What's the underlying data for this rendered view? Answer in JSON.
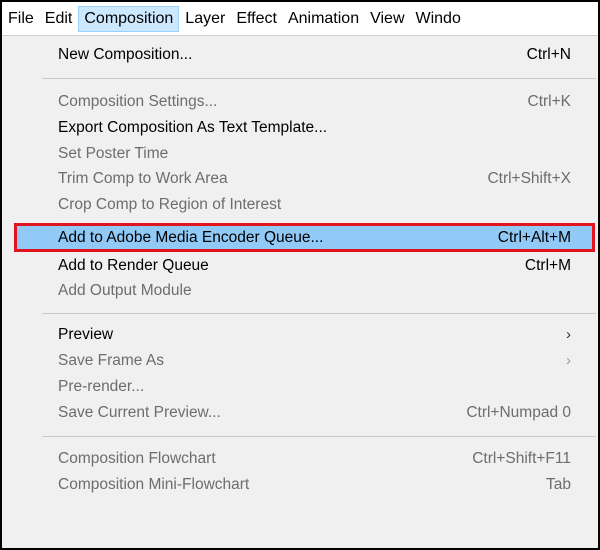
{
  "menubar": {
    "items": [
      "File",
      "Edit",
      "Composition",
      "Layer",
      "Effect",
      "Animation",
      "View",
      "Windo"
    ]
  },
  "menu": {
    "items": [
      {
        "label": "New Composition...",
        "shortcut": "Ctrl+N",
        "enabled": true
      },
      {
        "label": "Composition Settings...",
        "shortcut": "Ctrl+K",
        "enabled": false
      },
      {
        "label": "Export Composition As Text Template...",
        "shortcut": "",
        "enabled": true
      },
      {
        "label": "Set Poster Time",
        "shortcut": "",
        "enabled": false
      },
      {
        "label": "Trim Comp to Work Area",
        "shortcut": "Ctrl+Shift+X",
        "enabled": false
      },
      {
        "label": "Crop Comp to Region of Interest",
        "shortcut": "",
        "enabled": false
      },
      {
        "label": "Add to Adobe Media Encoder Queue...",
        "shortcut": "Ctrl+Alt+M",
        "enabled": true,
        "highlighted": true
      },
      {
        "label": "Add to Render Queue",
        "shortcut": "Ctrl+M",
        "enabled": true
      },
      {
        "label": "Add Output Module",
        "shortcut": "",
        "enabled": false
      },
      {
        "label": "Preview",
        "shortcut": "",
        "enabled": true,
        "submenu": true
      },
      {
        "label": "Save Frame As",
        "shortcut": "",
        "enabled": false,
        "submenu": true
      },
      {
        "label": "Pre-render...",
        "shortcut": "",
        "enabled": false
      },
      {
        "label": "Save Current Preview...",
        "shortcut": "Ctrl+Numpad 0",
        "enabled": false
      },
      {
        "label": "Composition Flowchart",
        "shortcut": "Ctrl+Shift+F11",
        "enabled": false
      },
      {
        "label": "Composition Mini-Flowchart",
        "shortcut": "Tab",
        "enabled": false
      }
    ]
  },
  "icons": {
    "submenu_arrow": "chevron-right-icon"
  },
  "colors": {
    "menu_bg": "#f0f0f0",
    "highlight_bg": "#91c9f7",
    "highlight_border": "#e2141d",
    "active_menubar_bg": "#cce8ff",
    "disabled_text": "#6d6d6d"
  }
}
